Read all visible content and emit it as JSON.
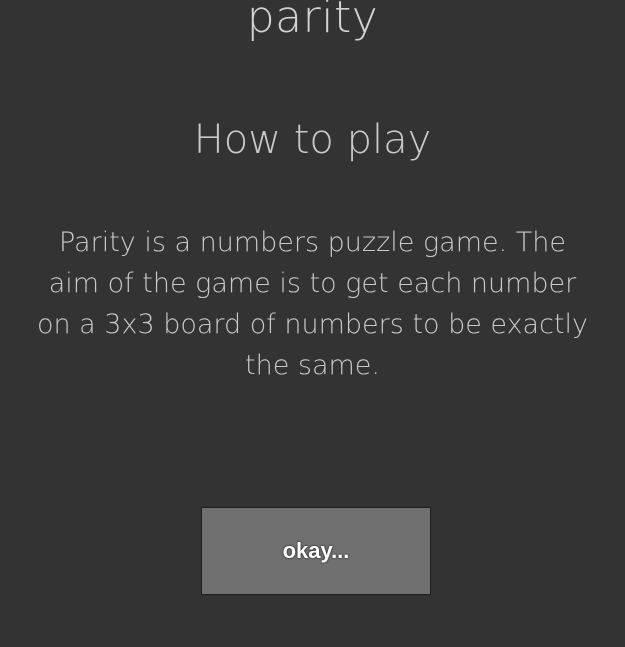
{
  "app": {
    "title": "parity"
  },
  "dialog": {
    "heading": "How to play",
    "body": "Parity is a numbers puzzle game. The aim of the game is to get each number on a 3x3 board of numbers to be exactly the same.",
    "confirm_label": "okay..."
  },
  "colors": {
    "background": "#333333",
    "text": "#c9c9c9",
    "button_background": "#707070",
    "button_text": "#ffffff"
  }
}
